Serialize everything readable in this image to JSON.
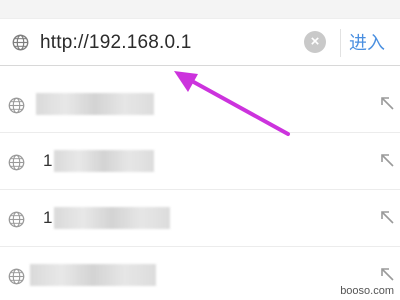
{
  "address_bar": {
    "url": "http://192.168.0.1",
    "clear_icon": "close-circle-icon",
    "enter_label": "进入"
  },
  "suggestions": [
    {
      "prefix": ""
    },
    {
      "prefix": "1"
    },
    {
      "prefix": "1"
    },
    {
      "prefix": ""
    }
  ],
  "watermark": "booso.com",
  "colors": {
    "accent": "#4a8fe0",
    "annotation_arrow": "#cc33dd",
    "icon_gray": "#9a9a9a"
  }
}
